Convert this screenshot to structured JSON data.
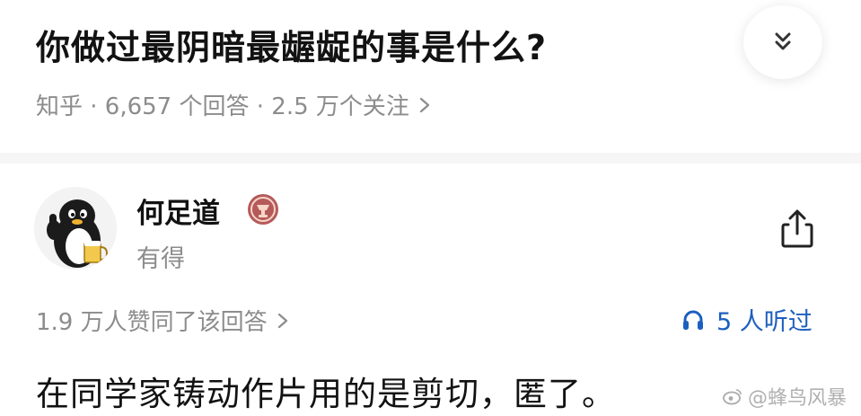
{
  "question": {
    "title": "你做过最阴暗最龌龊的事是什么?",
    "meta": "知乎 · 6,657 个回答 · 2.5 万个关注",
    "collapse_icon": "double-chevron-down-icon"
  },
  "author": {
    "name": "何足道",
    "bio": "有得",
    "avatar_icon": "penguin-avatar",
    "badge_icon": "badge-icon",
    "share_icon": "share-icon"
  },
  "stats": {
    "votes": "1.9 万人赞同了该回答",
    "listens": "5 人听过"
  },
  "answer": {
    "text": "在同学家铸动作片用的是剪切，匿了。"
  },
  "watermark": {
    "text": "@蜂鸟风暴"
  },
  "colors": {
    "accent": "#1d5fbf",
    "text": "#121212",
    "muted": "#8c8c8c",
    "badge": "#b55a5a"
  }
}
